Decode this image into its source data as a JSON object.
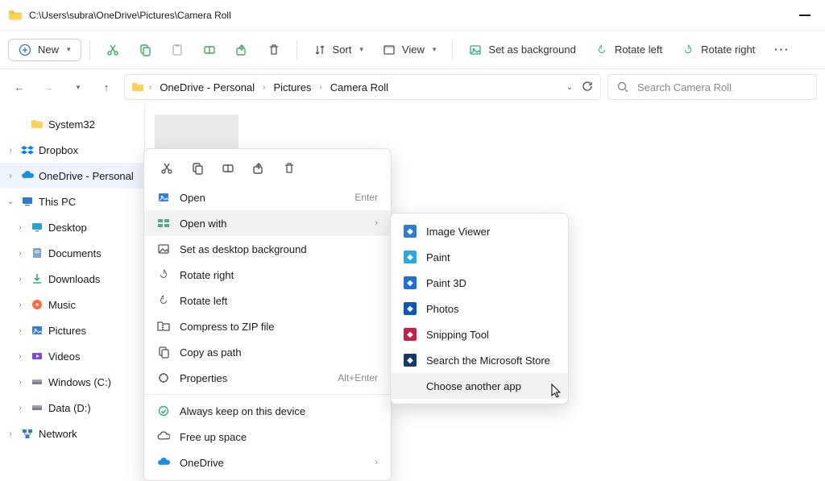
{
  "title_path": "C:\\Users\\subra\\OneDrive\\Pictures\\Camera Roll",
  "toolbar": {
    "new_label": "New",
    "sort_label": "Sort",
    "view_label": "View",
    "set_bg_label": "Set as background",
    "rotate_left_label": "Rotate left",
    "rotate_right_label": "Rotate right"
  },
  "breadcrumb": {
    "items": [
      "OneDrive - Personal",
      "Pictures",
      "Camera Roll"
    ]
  },
  "search": {
    "placeholder": "Search Camera Roll"
  },
  "sidebar": {
    "items": [
      {
        "label": "System32",
        "icon": "folder",
        "indent": 1,
        "expander": ""
      },
      {
        "label": "Dropbox",
        "icon": "dropbox",
        "indent": 0,
        "expander": "›"
      },
      {
        "label": "OneDrive - Personal",
        "icon": "onedrive",
        "indent": 0,
        "expander": "›",
        "selected": true
      },
      {
        "label": "This PC",
        "icon": "thispc",
        "indent": 0,
        "expander": "⌄",
        "section": true
      },
      {
        "label": "Desktop",
        "icon": "desktop",
        "indent": 1,
        "expander": "›"
      },
      {
        "label": "Documents",
        "icon": "documents",
        "indent": 1,
        "expander": "›"
      },
      {
        "label": "Downloads",
        "icon": "downloads",
        "indent": 1,
        "expander": "›"
      },
      {
        "label": "Music",
        "icon": "music",
        "indent": 1,
        "expander": "›"
      },
      {
        "label": "Pictures",
        "icon": "pictures",
        "indent": 1,
        "expander": "›"
      },
      {
        "label": "Videos",
        "icon": "videos",
        "indent": 1,
        "expander": "›"
      },
      {
        "label": "Windows (C:)",
        "icon": "drive",
        "indent": 1,
        "expander": "›"
      },
      {
        "label": "Data (D:)",
        "icon": "drive",
        "indent": 1,
        "expander": "›"
      },
      {
        "label": "Network",
        "icon": "network",
        "indent": 0,
        "expander": "›"
      }
    ]
  },
  "context_menu": {
    "items": [
      {
        "label": "Open",
        "icon": "image",
        "hint": "Enter"
      },
      {
        "label": "Open with",
        "icon": "openwith",
        "submenu": true,
        "hover": true
      },
      {
        "label": "Set as desktop background",
        "icon": "setbg"
      },
      {
        "label": "Rotate right",
        "icon": "rot_r"
      },
      {
        "label": "Rotate left",
        "icon": "rot_l"
      },
      {
        "label": "Compress to ZIP file",
        "icon": "zip"
      },
      {
        "label": "Copy as path",
        "icon": "copypath"
      },
      {
        "label": "Properties",
        "icon": "props",
        "hint": "Alt+Enter"
      },
      {
        "separator": true
      },
      {
        "label": "Always keep on this device",
        "icon": "keep"
      },
      {
        "label": "Free up space",
        "icon": "cloud"
      },
      {
        "label": "OneDrive",
        "icon": "onedrive",
        "submenu": true
      }
    ]
  },
  "openwith_menu": {
    "items": [
      {
        "label": "Image Viewer",
        "color": "#2d7dd2"
      },
      {
        "label": "Paint",
        "color": "#2aa8df"
      },
      {
        "label": "Paint 3D",
        "color": "#1e6fd9"
      },
      {
        "label": "Photos",
        "color": "#0a57c2"
      },
      {
        "label": "Snipping Tool",
        "color": "#c81e4a"
      },
      {
        "label": "Search the Microsoft Store",
        "color": "#143a6b"
      },
      {
        "label": "Choose another app",
        "noicon": true,
        "hover": true
      }
    ]
  }
}
